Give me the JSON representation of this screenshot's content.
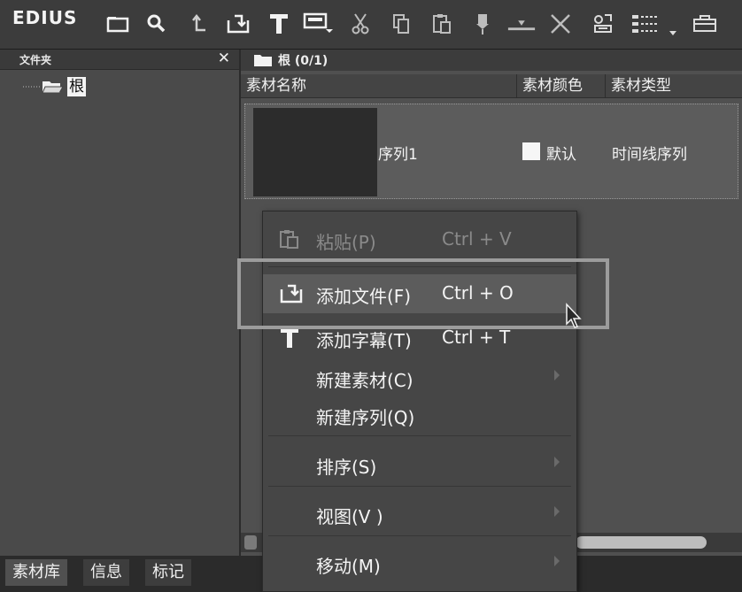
{
  "toolbar": {
    "brand": "EDIUS",
    "icons": [
      "new-folder-icon",
      "search-icon",
      "up-level-icon",
      "add-file-icon",
      "add-title-icon",
      "add-clip-icon",
      "cut-icon",
      "copy-icon",
      "paste-icon",
      "add-to-timeline-icon",
      "insert-to-timeline-icon",
      "delete-icon",
      "properties-icon",
      "view-icon",
      "settings-icon"
    ]
  },
  "left_panel": {
    "title": "文件夹",
    "close": "✕",
    "tree": {
      "root_label": "根"
    }
  },
  "right_panel": {
    "title": "根 (0/1)",
    "columns": [
      "素材名称",
      "素材颜色",
      "素材类型"
    ],
    "clips": [
      {
        "name": "序列1",
        "color_name": "默认",
        "type": "时间线序列",
        "color": "#f6f6f6"
      }
    ]
  },
  "context_menu": {
    "items": [
      {
        "label": "粘贴(P)",
        "shortcut": "Ctrl + V",
        "icon": "paste-icon",
        "enabled": false,
        "submenu": false
      },
      {
        "label": "添加文件(F)",
        "shortcut": "Ctrl + O",
        "icon": "add-file-icon",
        "enabled": true,
        "submenu": false,
        "highlighted": true
      },
      {
        "label": "添加字幕(T)",
        "shortcut": "Ctrl + T",
        "icon": "add-title-icon",
        "enabled": true,
        "submenu": false
      },
      {
        "label": "新建素材(C)",
        "shortcut": "",
        "icon": "",
        "enabled": true,
        "submenu": true
      },
      {
        "label": "新建序列(Q)",
        "shortcut": "",
        "icon": "",
        "enabled": true,
        "submenu": false
      },
      {
        "label": "排序(S)",
        "shortcut": "",
        "icon": "",
        "enabled": true,
        "submenu": true
      },
      {
        "label": "视图(V )",
        "shortcut": "",
        "icon": "",
        "enabled": true,
        "submenu": true
      },
      {
        "label": "移动(M)",
        "shortcut": "",
        "icon": "",
        "enabled": true,
        "submenu": true
      }
    ]
  },
  "tabs": [
    "素材库",
    "信息",
    "标记"
  ]
}
